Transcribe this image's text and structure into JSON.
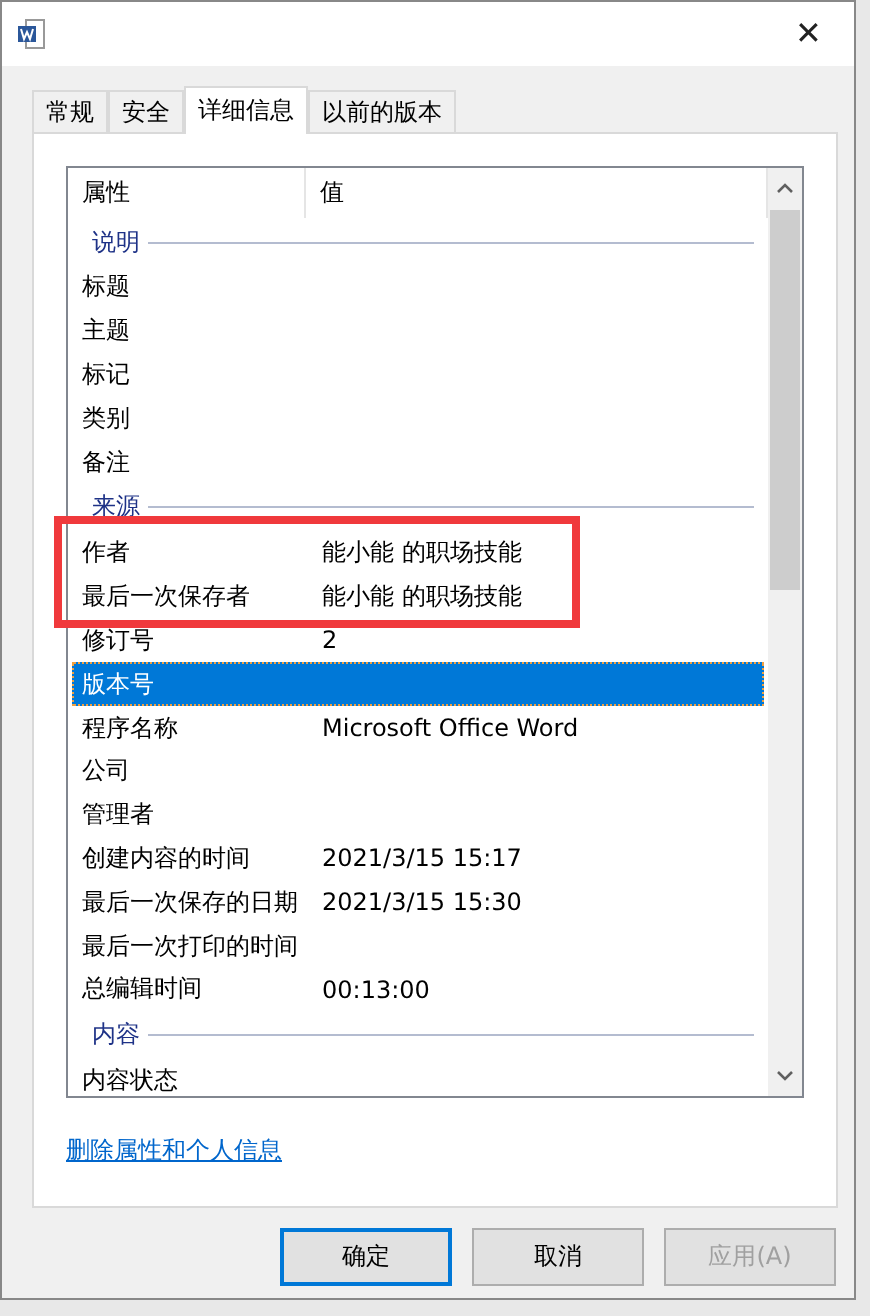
{
  "window": {
    "close": "✕"
  },
  "tabs": [
    {
      "label": "常规",
      "selected": false
    },
    {
      "label": "安全",
      "selected": false
    },
    {
      "label": "详细信息",
      "selected": true
    },
    {
      "label": "以前的版本",
      "selected": false
    }
  ],
  "table": {
    "columns": [
      "属性",
      "值"
    ],
    "rows": [
      {
        "kind": "section",
        "label": "说明"
      },
      {
        "kind": "property",
        "name": "标题",
        "selected": false
      },
      {
        "kind": "property",
        "name": "主题",
        "selected": false
      },
      {
        "kind": "property",
        "name": "标记",
        "selected": false
      },
      {
        "kind": "property",
        "name": "类别",
        "selected": false
      },
      {
        "kind": "property",
        "name": "备注",
        "selected": false
      },
      {
        "kind": "section",
        "label": "来源"
      },
      {
        "kind": "property",
        "name": "作者",
        "value": "能小能 的职场技能",
        "selected": false
      },
      {
        "kind": "property",
        "name": "最后一次保存者",
        "value": "能小能 的职场技能",
        "selected": false
      },
      {
        "kind": "property",
        "name": "修订号",
        "value": "2",
        "selected": false
      },
      {
        "kind": "property",
        "name": "版本号",
        "selected": true
      },
      {
        "kind": "property",
        "name": "程序名称",
        "value": "Microsoft Office Word",
        "selected": false
      },
      {
        "kind": "property",
        "name": "公司",
        "selected": false
      },
      {
        "kind": "property",
        "name": "管理者",
        "selected": false
      },
      {
        "kind": "property",
        "name": "创建内容的时间",
        "value": "2021/3/15 15:17",
        "selected": false
      },
      {
        "kind": "property",
        "name": "最后一次保存的日期",
        "value": "2021/3/15 15:30",
        "selected": false
      },
      {
        "kind": "property",
        "name": "最后一次打印的时间",
        "selected": false
      },
      {
        "kind": "property",
        "name": "总编辑时间",
        "value": "00:13:00",
        "selected": false
      },
      {
        "kind": "section",
        "label": "内容"
      },
      {
        "kind": "property",
        "name": "内容状态",
        "selected": false
      }
    ]
  },
  "link": "删除属性和个人信息",
  "buttons": [
    {
      "label": "确定",
      "default": true,
      "disabled": false
    },
    {
      "label": "取消",
      "default": false,
      "disabled": false
    },
    {
      "label": "应用(A)",
      "default": false,
      "disabled": true
    }
  ]
}
